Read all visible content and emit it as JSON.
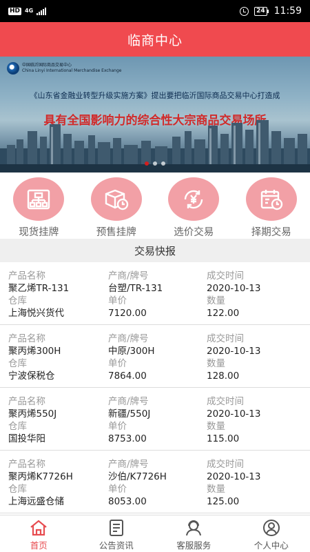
{
  "status_bar": {
    "hd": "HD",
    "network": "4G",
    "battery": "24",
    "time": "11:59"
  },
  "header": {
    "title": "临商中心"
  },
  "banner": {
    "logo_text_cn": "中国临沂国际商品交易中心",
    "logo_text_en": "China Linyi International Merchandise Exchange",
    "line1": "《山东省金融业转型升级实施方案》提出要把临沂国际商品交易中心打造成",
    "line2": "具有全国影响力的综合性大宗商品交易场所"
  },
  "shortcuts": [
    {
      "label": "现货挂牌",
      "icon": "org-chart-icon"
    },
    {
      "label": "预售挂牌",
      "icon": "box-clock-icon"
    },
    {
      "label": "选价交易",
      "icon": "yuan-exchange-icon"
    },
    {
      "label": "择期交易",
      "icon": "calendar-clock-icon"
    }
  ],
  "section": {
    "title": "交易快报"
  },
  "field_labels": {
    "product": "产品名称",
    "brand": "产商/牌号",
    "time": "成交时间",
    "warehouse": "仓库",
    "price": "单价",
    "quantity": "数量"
  },
  "records": [
    {
      "product": "聚乙烯TR-131",
      "brand": "台塑/TR-131",
      "time": "2020-10-13",
      "warehouse": "上海悦兴货代",
      "price": "7120.00",
      "quantity": "122.00"
    },
    {
      "product": "聚丙烯300H",
      "brand": "中原/300H",
      "time": "2020-10-13",
      "warehouse": "宁波保税仓",
      "price": "7864.00",
      "quantity": "128.00"
    },
    {
      "product": "聚丙烯550J",
      "brand": "新疆/550J",
      "time": "2020-10-13",
      "warehouse": "国投华阳",
      "price": "8753.00",
      "quantity": "115.00"
    },
    {
      "product": "聚丙烯K7726H",
      "brand": "沙伯/K7726H",
      "time": "2020-10-13",
      "warehouse": "上海远盛仓储",
      "price": "8053.00",
      "quantity": "125.00"
    }
  ],
  "bottom_nav": [
    {
      "label": "首页",
      "icon": "home-icon",
      "active": true
    },
    {
      "label": "公告资讯",
      "icon": "notice-icon",
      "active": false
    },
    {
      "label": "客服服务",
      "icon": "service-icon",
      "active": false
    },
    {
      "label": "个人中心",
      "icon": "user-icon",
      "active": false
    }
  ],
  "colors": {
    "primary": "#f04a4f",
    "icon_bg": "#f2a0a6",
    "active": "#e74c50"
  }
}
